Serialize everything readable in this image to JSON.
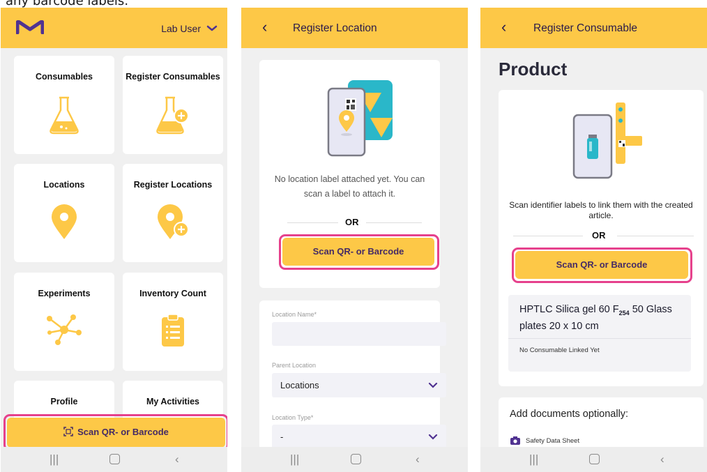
{
  "caption": "any barcode labels.",
  "colors": {
    "accent": "#fdc847",
    "highlight": "#e6418c",
    "button_text": "#442a65",
    "brand_purple": "#503291"
  },
  "nav_icons": [
    "recent-apps-icon",
    "home-icon",
    "back-icon"
  ],
  "screen1": {
    "user_menu": "Lab User",
    "tiles": [
      {
        "label": "Consumables",
        "icon": "flask-icon"
      },
      {
        "label": "Register Consumables",
        "icon": "flask-plus-icon"
      },
      {
        "label": "Locations",
        "icon": "location-pin-icon"
      },
      {
        "label": "Register Locations",
        "icon": "location-pin-plus-icon"
      },
      {
        "label": "Experiments",
        "icon": "network-icon"
      },
      {
        "label": "Inventory Count",
        "icon": "clipboard-icon"
      },
      {
        "label": "Profile"
      },
      {
        "label": "My Activities"
      }
    ],
    "scan_button": "Scan QR- or Barcode"
  },
  "screen2": {
    "title": "Register Location",
    "message": "No location label attached yet. You can scan a label to attach it.",
    "or": "OR",
    "scan_button": "Scan QR- or Barcode",
    "location_name_label": "Location Name*",
    "location_name_value": "",
    "parent_location_label": "Parent Location",
    "parent_location_value": "Locations",
    "location_type_label": "Location Type*",
    "location_type_value": "-"
  },
  "screen3": {
    "title": "Register Consumable",
    "heading": "Product",
    "message": "Scan identifier labels to link them with the created article.",
    "or": "OR",
    "scan_button": "Scan QR- or Barcode",
    "product_name_part1": "HPTLC Silica gel 60 F",
    "product_name_sub": "254",
    "product_name_part2": " 50 Glass plates 20 x 10 cm",
    "product_status": "No Consumable Linked Yet",
    "documents_title": "Add documents optionally:",
    "document_item": "Safety Data Sheet"
  }
}
